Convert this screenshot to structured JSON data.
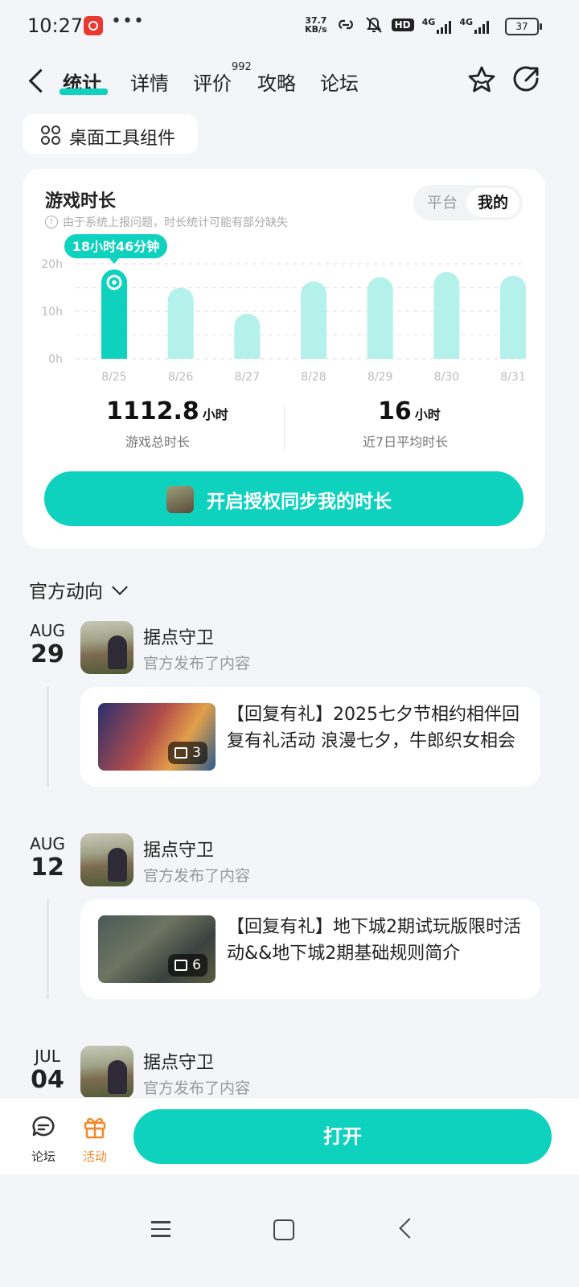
{
  "status_bar": {
    "time": "10:27",
    "network_speed": "37.7",
    "network_speed_unit": "KB/s",
    "hd_label": "HD",
    "signal1_label": "4G",
    "signal2_label": "4G",
    "battery": "37"
  },
  "nav": {
    "tabs": [
      {
        "label": "统计",
        "active": true
      },
      {
        "label": "详情"
      },
      {
        "label": "评价"
      },
      {
        "label": "攻略"
      },
      {
        "label": "论坛"
      }
    ],
    "review_count": "992",
    "icons": [
      "back-icon",
      "star-icon",
      "share-icon"
    ]
  },
  "widget_button": {
    "label": "桌面工具组件",
    "icon": "grid-icon"
  },
  "stats": {
    "title": "游戏时长",
    "note": "由于系统上报问题，时长统计可能有部分缺失",
    "toggle": {
      "platform": "平台",
      "mine": "我的",
      "selected": "我的"
    },
    "total_value": "1112.8",
    "total_unit": "小时",
    "total_label": "游戏总时长",
    "avg_value": "16",
    "avg_unit": "小时",
    "avg_label": "近7日平均时长",
    "sync_button": "开启授权同步我的时长"
  },
  "chart_data": {
    "type": "bar",
    "categories": [
      "8/25",
      "8/26",
      "8/27",
      "8/28",
      "8/29",
      "8/30",
      "8/31"
    ],
    "values": [
      18.8,
      15,
      9.5,
      16.3,
      17.2,
      18.3,
      17.5
    ],
    "y_ticks": [
      "0h",
      "10h",
      "20h"
    ],
    "ylim": [
      0,
      20
    ],
    "selected_index": 0,
    "tooltip": "18小时46分钟",
    "grid": "dashed",
    "colors": {
      "selected": "#0fd2be",
      "default": "#b3f1ea"
    }
  },
  "official": {
    "title": "官方动向",
    "posts": [
      {
        "month": "AUG",
        "day": "29",
        "name": "据点守卫",
        "meta": "官方发布了内容",
        "title": "【回复有礼】2025七夕节相约相伴回复有礼活动 浪漫七夕，牛郎织女相会",
        "image_count": "3"
      },
      {
        "month": "AUG",
        "day": "12",
        "name": "据点守卫",
        "meta": "官方发布了内容",
        "title": "【回复有礼】地下城2期试玩版限时活动&&地下城2期基础规则简介",
        "image_count": "6"
      },
      {
        "month": "JUL",
        "day": "04",
        "name": "据点守卫",
        "meta": "官方发布了内容"
      }
    ]
  },
  "bottom_bar": {
    "forum_label": "论坛",
    "activity_label": "活动",
    "open_button": "打开",
    "accent_color": "#0fd2be",
    "activity_color": "#f08a2c"
  }
}
